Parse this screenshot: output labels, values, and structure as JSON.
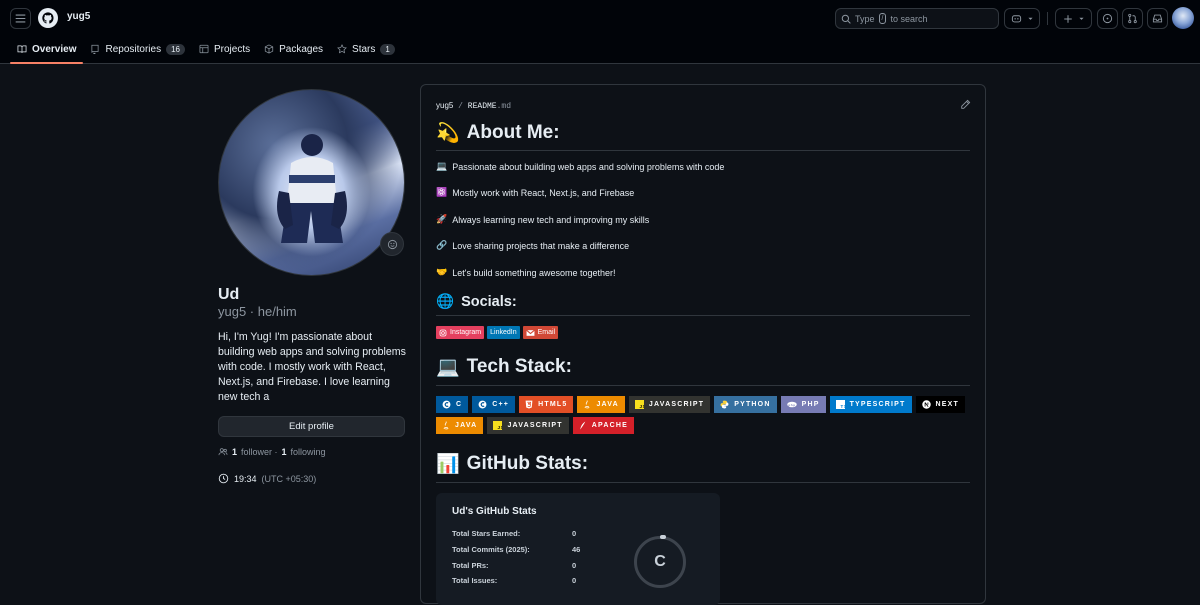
{
  "topbar": {
    "username": "yug5",
    "search_prefix": "Type",
    "search_key": "/",
    "search_suffix": "to search"
  },
  "nav": {
    "tabs": [
      {
        "label": "Overview",
        "icon": "book-icon"
      },
      {
        "label": "Repositories",
        "icon": "repo-icon",
        "count": "16"
      },
      {
        "label": "Projects",
        "icon": "table-icon"
      },
      {
        "label": "Packages",
        "icon": "package-icon"
      },
      {
        "label": "Stars",
        "icon": "star-icon",
        "count": "1"
      }
    ]
  },
  "profile": {
    "name": "Ud",
    "login": "yug5 · he/him",
    "bio": "Hi, I'm Yug! I'm passionate about building web apps and solving problems with code. I mostly work with React, Next.js, and Firebase. I love learning new tech a",
    "edit_label": "Edit profile",
    "followers_count": "1",
    "followers_label": "follower ·",
    "following_count": "1",
    "following_label": "following",
    "local_time": "19:34",
    "timezone": "(UTC +05:30)"
  },
  "readme": {
    "owner": "yug5",
    "sep": "/",
    "file": "README",
    "ext": ".md",
    "about_title": "About Me:",
    "about_emoji": "💫",
    "about_items": [
      {
        "emoji": "💻",
        "text": "Passionate about building web apps and solving problems with code"
      },
      {
        "emoji": "⚛️",
        "text": "Mostly work with React, Next.js, and Firebase"
      },
      {
        "emoji": "🚀",
        "text": "Always learning new tech and improving my skills"
      },
      {
        "emoji": "🔗",
        "text": "Love sharing projects that make a difference"
      },
      {
        "emoji": "🤝",
        "text": "Let's build something awesome together!"
      }
    ],
    "socials_title": "Socials:",
    "socials_emoji": "🌐",
    "socials": [
      {
        "label": "Instagram",
        "color": "#E4405F"
      },
      {
        "label": "LinkedIn",
        "color": "#0077B5"
      },
      {
        "label": "Email",
        "color": "#D14836"
      }
    ],
    "tech_title": "Tech Stack:",
    "tech_emoji": "💻",
    "tech": [
      {
        "label": "C",
        "color": "#00599C"
      },
      {
        "label": "C++",
        "color": "#00599C"
      },
      {
        "label": "HTML5",
        "color": "#E34F26"
      },
      {
        "label": "JAVA",
        "color": "#ED8B00"
      },
      {
        "label": "JAVASCRIPT",
        "color": "#323330"
      },
      {
        "label": "PYTHON",
        "color": "#3670A0"
      },
      {
        "label": "PHP",
        "color": "#777BB4"
      },
      {
        "label": "TYPESCRIPT",
        "color": "#007ACC"
      },
      {
        "label": "NEXT",
        "color": "#000000"
      },
      {
        "label": "JAVA",
        "color": "#ED8B00"
      },
      {
        "label": "JAVASCRIPT",
        "color": "#323330"
      },
      {
        "label": "APACHE",
        "color": "#D42029"
      }
    ],
    "stats_title": "GitHub Stats:",
    "stats_emoji": "📊",
    "stats_card": {
      "title": "Ud's GitHub Stats",
      "rows": [
        {
          "label": "Total Stars Earned:",
          "value": "0"
        },
        {
          "label": "Total Commits (2025):",
          "value": "46"
        },
        {
          "label": "Total PRs:",
          "value": "0"
        },
        {
          "label": "Total Issues:",
          "value": "0"
        }
      ],
      "grade": "C"
    }
  },
  "colors": {
    "accent_underline": "#f78166",
    "bg": "#0d1117",
    "topbar_bg": "#010409",
    "border": "#30363d"
  }
}
